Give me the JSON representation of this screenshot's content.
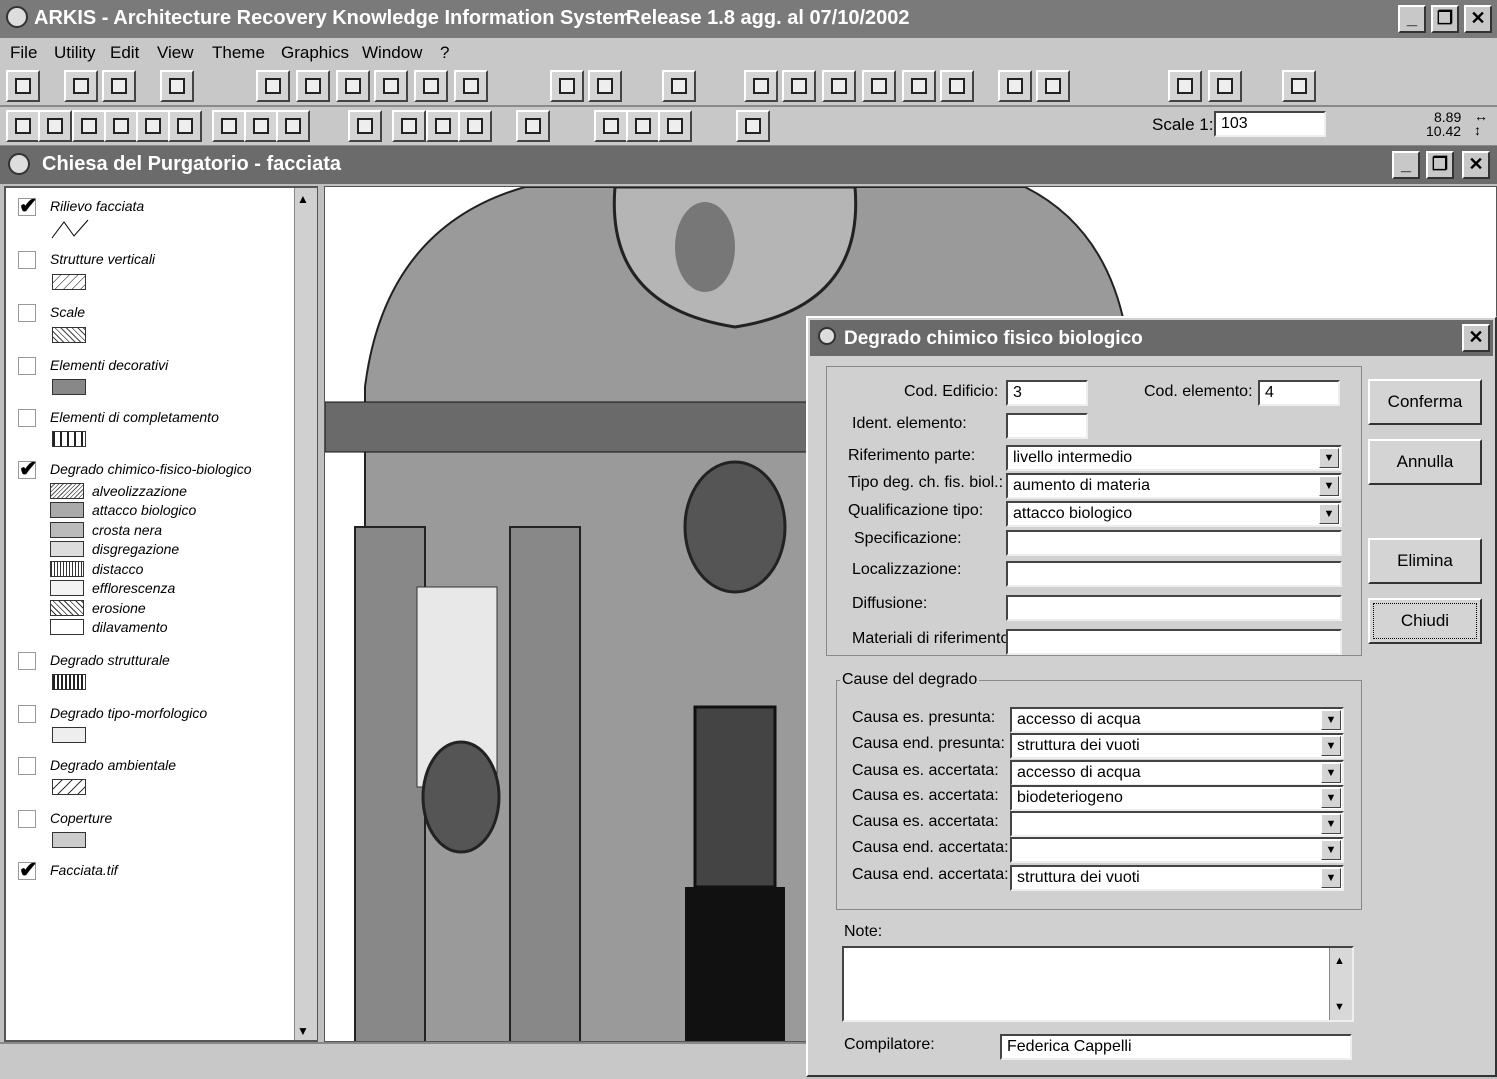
{
  "app": {
    "title": "ARKIS - Architecture Recovery Knowledge Information System",
    "release": "Release 1.8  agg. al 07/10/2002"
  },
  "menu": [
    "File",
    "Utility",
    "Edit",
    "View",
    "Theme",
    "Graphics",
    "Window",
    "?"
  ],
  "toolbar2": {
    "scale_label": "Scale 1:",
    "scale_value": "103",
    "coord_x": "8.89",
    "coord_y": "10.42"
  },
  "child": {
    "title": "Chiesa del Purgatorio - facciata"
  },
  "legend": {
    "layers": [
      {
        "name": "Rilievo facciata",
        "checked": true
      },
      {
        "name": "Strutture verticali",
        "checked": false
      },
      {
        "name": "Scale",
        "checked": false
      },
      {
        "name": "Elementi decorativi",
        "checked": false
      },
      {
        "name": "Elementi di completamento",
        "checked": false
      },
      {
        "name": "Degrado chimico-fisico-biologico",
        "checked": true
      },
      {
        "name": "Degrado strutturale",
        "checked": false
      },
      {
        "name": "Degrado tipo-morfologico",
        "checked": false
      },
      {
        "name": "Degrado ambientale",
        "checked": false
      },
      {
        "name": "Coperture",
        "checked": false
      },
      {
        "name": "Facciata.tif",
        "checked": true
      }
    ],
    "sublayers": [
      "alveolizzazione",
      "attacco biologico",
      "crosta nera",
      "disgregazione",
      "distacco",
      "efflorescenza",
      "erosione",
      "dilavamento"
    ]
  },
  "dialog": {
    "title": "Degrado chimico fisico biologico",
    "cod_edificio_label": "Cod. Edificio:",
    "cod_edificio": "3",
    "cod_elemento_label": "Cod. elemento:",
    "cod_elemento": "4",
    "ident_label": "Ident. elemento:",
    "ident": "",
    "rif_parte_label": "Riferimento parte:",
    "rif_parte": "livello intermedio",
    "tipo_deg_label": "Tipo deg. ch. fis. biol.:",
    "tipo_deg": "aumento di materia",
    "qualif_label": "Qualificazione tipo:",
    "qualif": "attacco biologico",
    "spec_label": "Specificazione:",
    "loc_label": "Localizzazione:",
    "diff_label": "Diffusione:",
    "mat_label": "Materiali di riferimento:",
    "cause_group": "Cause del degrado",
    "causes": [
      {
        "label": "Causa es. presunta:",
        "value": "accesso di acqua"
      },
      {
        "label": "Causa end. presunta:",
        "value": "struttura dei vuoti"
      },
      {
        "label": "Causa es. accertata:",
        "value": "accesso di acqua"
      },
      {
        "label": "Causa es. accertata:",
        "value": "biodeteriogeno"
      },
      {
        "label": "Causa es. accertata:",
        "value": ""
      },
      {
        "label": "Causa end. accertata:",
        "value": ""
      },
      {
        "label": "Causa end. accertata:",
        "value": "struttura dei vuoti"
      }
    ],
    "note_label": "Note:",
    "compilatore_label": "Compilatore:",
    "compilatore": "Federica Cappelli",
    "buttons": {
      "conferma": "Conferma",
      "annulla": "Annulla",
      "elimina": "Elimina",
      "chiudi": "Chiudi"
    }
  }
}
